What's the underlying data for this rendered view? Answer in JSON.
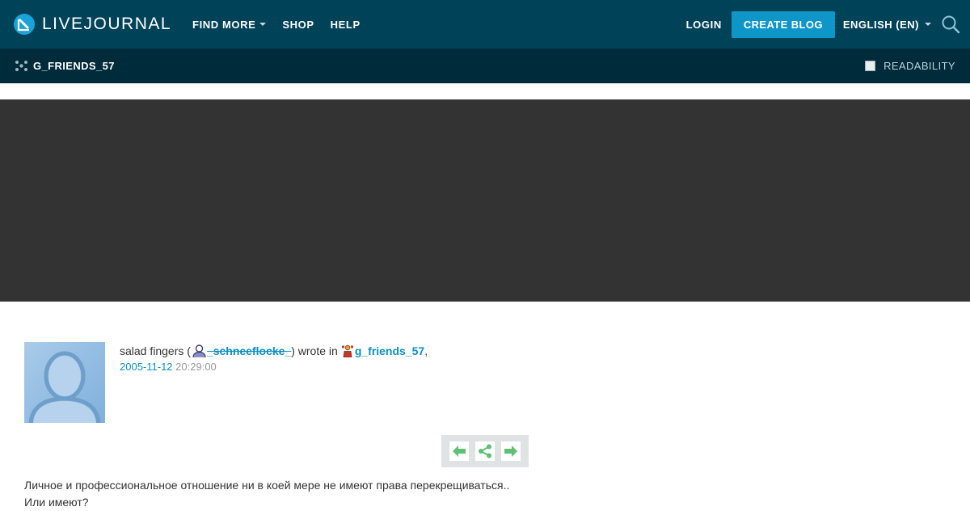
{
  "header": {
    "logo_text": "LIVEJOURNAL",
    "nav": [
      {
        "label": "FIND MORE",
        "has_dropdown": true
      },
      {
        "label": "SHOP",
        "has_dropdown": false
      },
      {
        "label": "HELP",
        "has_dropdown": false
      }
    ],
    "login_label": "LOGIN",
    "create_blog_label": "CREATE BLOG",
    "language_label": "ENGLISH (EN)",
    "search_icon": "search-icon",
    "colors": {
      "bar": "#004359",
      "accent": "#0e96c8"
    }
  },
  "subbar": {
    "community_name": "G_FRIENDS_57",
    "community_icon": "community-icon",
    "readability_label": "READABILITY",
    "readability_checked": false,
    "color": "#002b3a"
  },
  "banner": {
    "color": "#333333"
  },
  "entry": {
    "author_display": "salad fingers (",
    "username": "_schneeflocke_",
    "wrote_in": ") wrote in",
    "community": "g_friends_57",
    "comma": ",",
    "date": "2005-11-12",
    "time": "20:29:00",
    "link_color": "#0b8fc5"
  },
  "actions": [
    {
      "name": "prev-entry",
      "icon": "arrow-left-icon"
    },
    {
      "name": "share",
      "icon": "share-icon"
    },
    {
      "name": "next-entry",
      "icon": "arrow-right-icon"
    }
  ],
  "post": {
    "line1": "Личное и профессиональное отношение ни в коей мере не имеют права перекрещиваться..",
    "line2": "Или имеют?"
  }
}
